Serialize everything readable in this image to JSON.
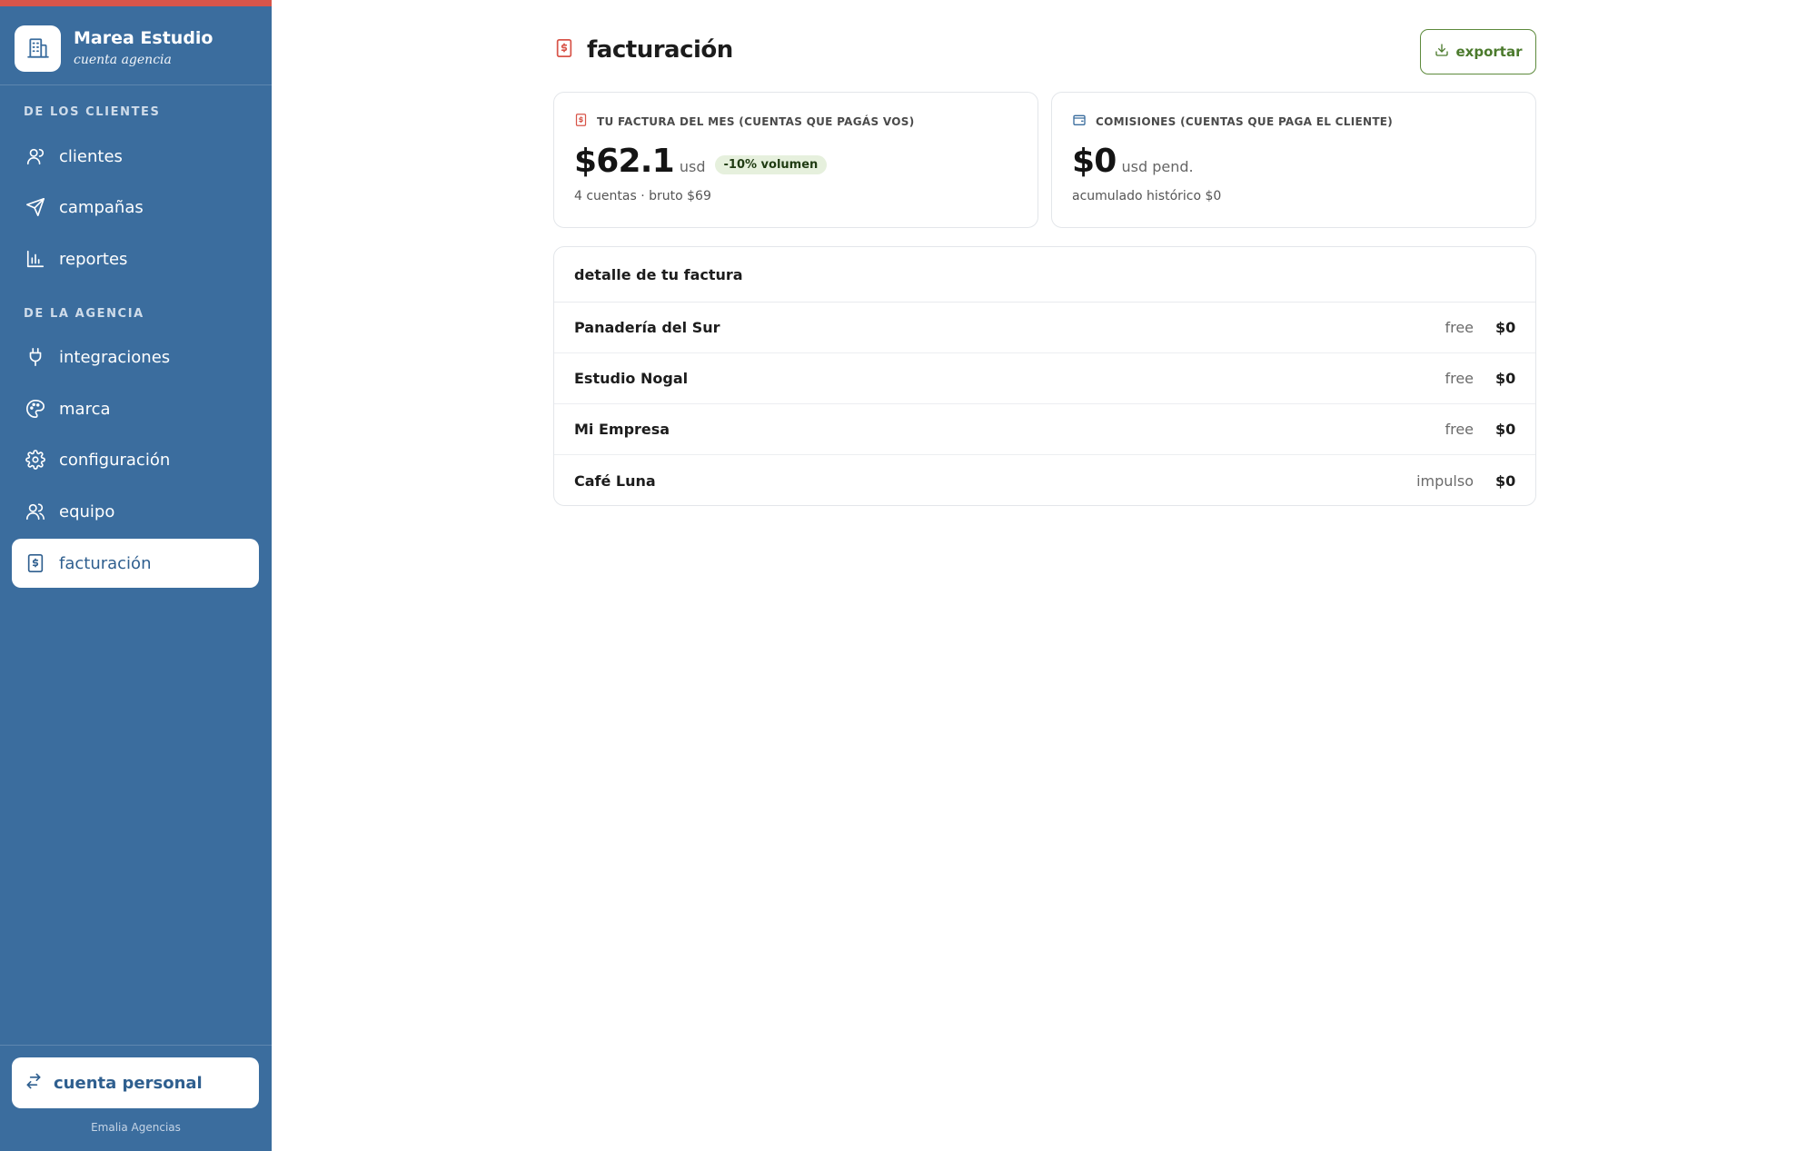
{
  "brand": {
    "name": "Marea Estudio",
    "subtitle": "cuenta agencia"
  },
  "sidebar": {
    "sections": [
      {
        "title": "DE LOS CLIENTES"
      },
      {
        "title": "DE LA AGENCIA"
      }
    ],
    "items": [
      {
        "label": "clientes",
        "icon": "users-icon"
      },
      {
        "label": "campañas",
        "icon": "send-icon"
      },
      {
        "label": "reportes",
        "icon": "bar-chart-icon"
      },
      {
        "label": "integraciones",
        "icon": "plug-icon"
      },
      {
        "label": "marca",
        "icon": "palette-icon"
      },
      {
        "label": "configuración",
        "icon": "gear-icon"
      },
      {
        "label": "equipo",
        "icon": "team-icon"
      },
      {
        "label": "facturación",
        "icon": "invoice-icon",
        "active": true
      }
    ],
    "personal_button": "cuenta personal",
    "footer": "Emalia Agencias"
  },
  "header": {
    "title": "facturación",
    "export_label": "exportar"
  },
  "cards": {
    "invoice": {
      "label": "TU FACTURA DEL MES (CUENTAS QUE PAGÁS VOS)",
      "amount": "$62.1",
      "unit": "usd",
      "badge": "-10% volumen",
      "meta": "4 cuentas · bruto $69"
    },
    "commissions": {
      "label": "COMISIONES (CUENTAS QUE PAGA EL CLIENTE)",
      "amount": "$0",
      "unit": "usd pend.",
      "meta": "acumulado histórico $0"
    }
  },
  "detail": {
    "title": "detalle de tu factura",
    "rows": [
      {
        "name": "Panadería del Sur",
        "plan": "free",
        "amount": "$0"
      },
      {
        "name": "Estudio Nogal",
        "plan": "free",
        "amount": "$0"
      },
      {
        "name": "Mi Empresa",
        "plan": "free",
        "amount": "$0"
      },
      {
        "name": "Café Luna",
        "plan": "impulso",
        "amount": "$0"
      }
    ]
  },
  "colors": {
    "sidebar": "#3b6d9e",
    "accent_red": "#d8554a",
    "export_green": "#4b7a2c"
  }
}
